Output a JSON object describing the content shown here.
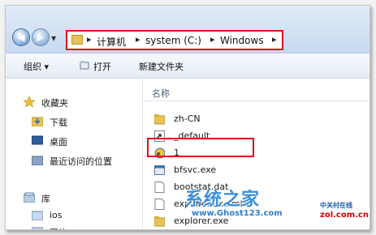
{
  "address_bar": {
    "crumbs": [
      "计算机",
      "system (C:)",
      "Windows"
    ],
    "separator": "▸"
  },
  "toolbar": {
    "organize": "组织 ▾",
    "open": "打开",
    "new_folder": "新建文件夹"
  },
  "nav_pane": {
    "favorites": "收藏夹",
    "items": [
      "下载",
      "桌面",
      "最近访问的位置"
    ],
    "libraries": "库",
    "lib_items": [
      "ios",
      "图片"
    ]
  },
  "content": {
    "column_header": "名称",
    "files": [
      {
        "name": "zh-CN",
        "icon": "folder-icon"
      },
      {
        "name": "_default",
        "icon": "shortcut-icon"
      },
      {
        "name": "1",
        "icon": "shortcut-icon"
      },
      {
        "name": "bfsvc.exe",
        "icon": "exe-icon"
      },
      {
        "name": "bootstat.dat",
        "icon": "file-icon"
      },
      {
        "name": "explorer.exe.ml",
        "icon": "file-icon"
      },
      {
        "name": "explorer.exe",
        "icon": "folder-icon"
      }
    ]
  },
  "watermark": {
    "brand": "系统之家",
    "url": "www.Ghost123.com",
    "logo_line1": "中关村在线",
    "logo_line2": "zol.com.cn"
  },
  "colors": {
    "highlight_border": "#d9141b",
    "folder": "#e8c35a"
  }
}
